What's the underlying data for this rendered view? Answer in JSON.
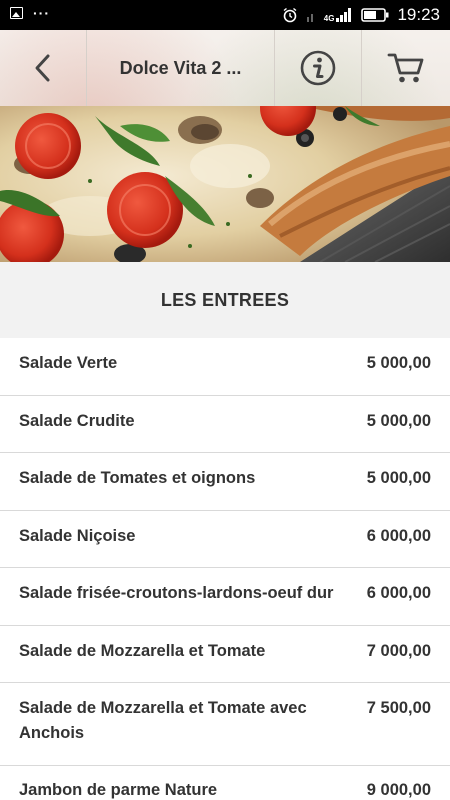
{
  "status_bar": {
    "time": "19:23",
    "network": "4G",
    "left_icons": [
      "image-icon",
      "more-dots-icon"
    ],
    "right_icons": [
      "alarm-icon",
      "signal-icon",
      "battery-icon"
    ]
  },
  "header": {
    "back_icon": "chevron-left-icon",
    "title": "Dolce Vita 2 ...",
    "info_icon": "info-circle-icon",
    "cart_icon": "cart-icon"
  },
  "hero": {
    "description_icon": "pizza-photo"
  },
  "section": {
    "title": "LES ENTREES"
  },
  "menu": {
    "items": [
      {
        "name": "Salade Verte",
        "price": "5 000,00"
      },
      {
        "name": "Salade Crudite",
        "price": "5 000,00"
      },
      {
        "name": "Salade de Tomates et oignons",
        "price": "5 000,00"
      },
      {
        "name": "Salade Niçoise",
        "price": "6 000,00"
      },
      {
        "name": "Salade frisée-croutons-lardons-oeuf dur",
        "price": "6 000,00"
      },
      {
        "name": "Salade de Mozzarella et Tomate",
        "price": "7 000,00"
      },
      {
        "name": "Salade de Mozzarella et Tomate avec Anchois",
        "price": "7 500,00"
      },
      {
        "name": "Jambon de parme Nature",
        "price": "9 000,00"
      }
    ]
  },
  "colors": {
    "status_bar_bg": "#000000",
    "section_bg": "#f2f2f2",
    "text": "#333333",
    "divider": "#d9d9d9"
  }
}
